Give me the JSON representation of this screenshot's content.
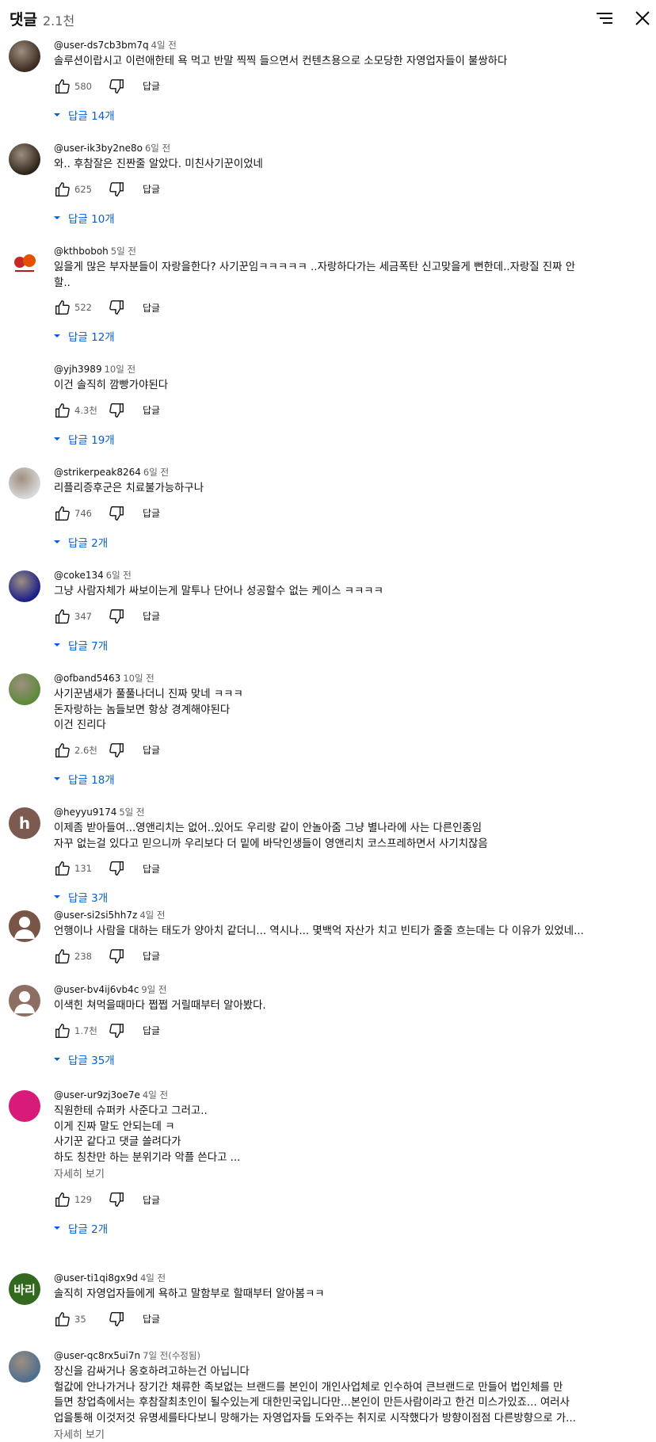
{
  "header": {
    "title": "댓글",
    "count": "2.1천",
    "sort_icon": "sort-icon",
    "close_icon": "close-icon"
  },
  "comments": [
    {
      "author": "@user-ds7cb3bm7q",
      "time": "4일 전",
      "lines": [
        "솔루션이랍시고 이런애한테 욕 먹고 반말 찍찍 들으면서 컨텐츠용으로 소모당한 자영업자들이 불쌍하다"
      ],
      "likes": "580",
      "reply_label": "답글",
      "replies": "답글 14개",
      "avatar": {
        "type": "photo",
        "color": "#3b2a20"
      }
    },
    {
      "author": "@user-ik3by2ne8o",
      "time": "6일 전",
      "lines": [
        "와.. 후참잘은 진짠줄 알았다. 미친사기꾼이었네"
      ],
      "likes": "625",
      "reply_label": "답글",
      "replies": "답글 10개",
      "avatar": {
        "type": "photo",
        "color": "#2d2418"
      }
    },
    {
      "author": "@kthboboh",
      "time": "5일 전",
      "lines": [
        "잃을게 많은 부자분들이 자랑을한다? 사기꾼임ㅋㅋㅋㅋㅋ ..자랑하다가는 세금폭탄 신고맞을게 뻔한데..자랑질 진짜 안",
        "할.."
      ],
      "likes": "522",
      "reply_label": "답글",
      "replies": "답글 12개",
      "avatar": {
        "type": "logo",
        "color": "#ffffff"
      }
    },
    {
      "author": "@yjh3989",
      "time": "10일 전",
      "lines": [
        "이건 솔직히 깜빵가야된다"
      ],
      "likes": "4.3천",
      "reply_label": "답글",
      "replies": "답글 19개",
      "avatar": {
        "type": "blank",
        "color": "#ffffff"
      }
    },
    {
      "author": "@strikerpeak8264",
      "time": "6일 전",
      "lines": [
        "리플리증후군은 치료불가능하구나"
      ],
      "likes": "746",
      "reply_label": "답글",
      "replies": "답글 2개",
      "avatar": {
        "type": "photo",
        "color": "#d8d8d8"
      }
    },
    {
      "author": "@coke134",
      "time": "6일 전",
      "lines": [
        "그냥 사람자체가 싸보이는게 말투나 단어나 성공할수 없는 케이스 ㅋㅋㅋㅋ"
      ],
      "likes": "347",
      "reply_label": "답글",
      "replies": "답글 7개",
      "avatar": {
        "type": "photo",
        "color": "#1a1f8a"
      }
    },
    {
      "author": "@ofband5463",
      "time": "10일 전",
      "lines": [
        "사기꾼냄새가 풀풀나더니 진짜 맞네 ㅋㅋㅋ",
        "돈자랑하는 놈들보면 항상 경계해야된다",
        "이건 진리다"
      ],
      "likes": "2.6천",
      "reply_label": "답글",
      "replies": "답글 18개",
      "avatar": {
        "type": "photo",
        "color": "#5c8a3a"
      }
    },
    {
      "author": "@heyyu9174",
      "time": "5일 전",
      "lines": [
        "이제좀 받아들여...영앤리치는 없어..있어도 우리랑 같이 안놀아줌 그냥 별나라에 사는 다른인종임",
        "자꾸 없는걸 있다고 믿으니까 우리보다 더 밑에 바닥인생들이 영앤리치 코스프레하면서 사기치잖음"
      ],
      "likes": "131",
      "reply_label": "답글",
      "replies": "답글 3개",
      "avatar": {
        "type": "letter",
        "color": "#7d5a50",
        "letter": "h"
      }
    },
    {
      "author": "@user-si2si5hh7z",
      "time": "4일 전",
      "lines": [
        "언행이나 사람을 대하는 태도가 양아치 같더니... 역시나... 몇백억 자산가 치고 빈티가 줄줄 흐는데는 다 이유가 있었네..."
      ],
      "likes": "238",
      "reply_label": "답글",
      "replies": "",
      "avatar": {
        "type": "person",
        "color": "#795548"
      }
    },
    {
      "author": "@user-bv4ij6vb4c",
      "time": "9일 전",
      "lines": [
        "이색힌 쳐먹을때마다 쩝쩝 거릴때부터 알아봤다."
      ],
      "likes": "1.7천",
      "reply_label": "답글",
      "replies": "답글 35개",
      "avatar": {
        "type": "person",
        "color": "#8d6e63"
      }
    },
    {
      "author": "@user-ur9zj3oe7e",
      "time": "4일 전",
      "lines": [
        "직원한테 슈퍼카 사준다고 그러고..",
        "이게 진짜 말도 안되는데 ㅋ",
        "사기꾼 같다고 댓글 쓸려다가",
        "하도 칭찬만 하는 분위기라 악플 쓴다고 ..."
      ],
      "more": "자세히 보기",
      "likes": "129",
      "reply_label": "답글",
      "replies": "답글 2개",
      "avatar": {
        "type": "solid",
        "color": "#d81b7a"
      }
    },
    {
      "author": "@user-ti1qi8gx9d",
      "time": "4일 전",
      "lines": [
        "솔직히 자영업자들에게 욕하고 말함부로 할때부터 알아봄ㅋㅋ"
      ],
      "likes": "35",
      "reply_label": "답글",
      "replies": "",
      "avatar": {
        "type": "letter",
        "color": "#33691e",
        "letter": "바리"
      }
    },
    {
      "author": "@user-qc8rx5ui7n",
      "time": "7일 전(수정됨)",
      "lines": [
        "장신을 감싸거나 옹호하려고하는건 아닙니다",
        "헐값에 안나가거나 장기간 채류한 족보없는 브랜드를 본인이 개인사업체로 인수하여 큰브랜드로 만들어 법인체를 만",
        "들면 창업측에서는 후참잘최초인이 될수있는게 대한민국입니다만...본인이 만든사람이라고 한건 미스가있죠... 여러사",
        "업을통해 이것저것 유명세를타다보니 망해가는 자영업자들 도와주는 취지로 시작했다가 방향이점점 다른방향으로 가..."
      ],
      "more": "자세히 보기",
      "likes": "",
      "reply_label": "",
      "replies": "",
      "avatar": {
        "type": "photo",
        "color": "#4e6e8e"
      }
    }
  ]
}
